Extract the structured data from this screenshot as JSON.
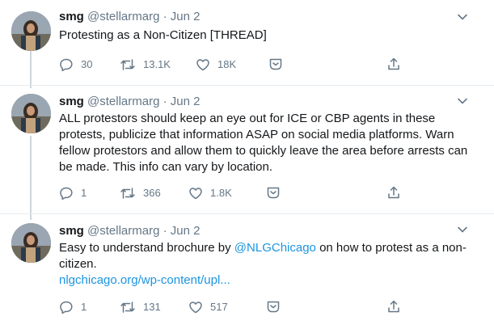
{
  "tweets": [
    {
      "name": "smg",
      "handle": "@stellarmarg",
      "sep": "·",
      "date": "Jun 2",
      "text": "Protesting as a Non-Citizen [THREAD]",
      "replies": "30",
      "retweets": "13.1K",
      "likes": "18K"
    },
    {
      "name": "smg",
      "handle": "@stellarmarg",
      "sep": "·",
      "date": "Jun 2",
      "text": "ALL protestors should keep an eye out for ICE or CBP agents in these protests, publicize that information ASAP on social media platforms. Warn fellow protestors and allow them to quickly leave the area before arrests can be made. This info can vary by location.",
      "replies": "1",
      "retweets": "366",
      "likes": "1.8K"
    },
    {
      "name": "smg",
      "handle": "@stellarmarg",
      "sep": "·",
      "date": "Jun 2",
      "text_before": "Easy to understand brochure by ",
      "mention": "@NLGChicago",
      "text_after": " on how to protest as a non-citizen.",
      "url": "nlgchicago.org/wp-content/upl...",
      "replies": "1",
      "retweets": "131",
      "likes": "517"
    }
  ],
  "colors": {
    "text": "#14171a",
    "muted": "#657786",
    "link": "#1b95e0",
    "thread_line": "#ccd6dd",
    "divider": "#e6ecf0"
  },
  "icons": [
    "avatar",
    "chevron-down-icon",
    "reply-icon",
    "retweet-icon",
    "like-icon",
    "message-icon",
    "share-icon"
  ]
}
